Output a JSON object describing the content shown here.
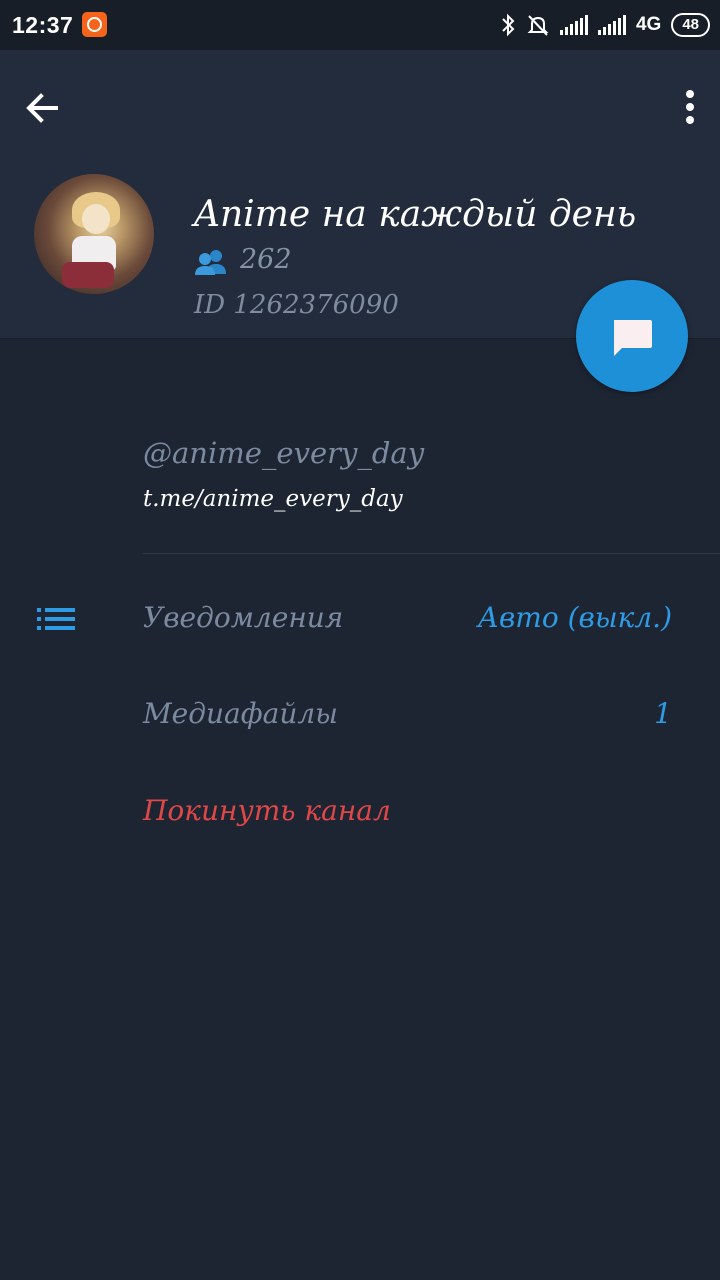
{
  "status_bar": {
    "time": "12:37",
    "network": "4G",
    "battery": "48"
  },
  "header": {
    "back_icon": "arrow-left-icon",
    "menu_icon": "more-vertical-icon",
    "channel_title": "Anime на каждый день",
    "members_count": "262",
    "channel_id": "ID 1262376090"
  },
  "fab": {
    "icon": "chat-bubble-icon",
    "color": "#1e90d8"
  },
  "info": {
    "username": "@anime_every_day",
    "link": "t.me/anime_every_day"
  },
  "settings": {
    "notifications_label": "Уведомления",
    "notifications_value": "Авто (выкл.)",
    "media_label": "Медиафайлы",
    "media_value": "1",
    "leave_label": "Покинуть канал"
  },
  "colors": {
    "background": "#1d2533",
    "header": "#222c3c",
    "accent": "#2e9be4",
    "danger": "#e04848"
  }
}
